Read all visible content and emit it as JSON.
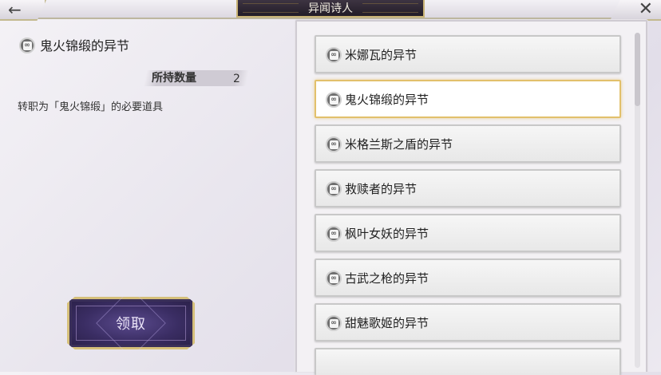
{
  "header": {
    "title": "异闻诗人",
    "back_icon": "left-arrow-icon",
    "close_icon": "close-icon"
  },
  "detail": {
    "name": "鬼火锦缎的异节",
    "quantity_label": "所持数量",
    "quantity_value": "2",
    "description": "转职为「鬼火锦缎」的必要道具",
    "claim_button": "领取"
  },
  "list": {
    "items": [
      {
        "name": "米娜瓦的异节"
      },
      {
        "name": "鬼火锦缎的异节"
      },
      {
        "name": "米格兰斯之盾的异节"
      },
      {
        "name": "救赎者的异节"
      },
      {
        "name": "枫叶女妖的异节"
      },
      {
        "name": "古武之枪的异节"
      },
      {
        "name": "甜魅歌姬的异节"
      }
    ],
    "selected_index": 1
  },
  "colors": {
    "accent_gold": "#e2c06b",
    "button_purple": "#3a2d63"
  }
}
